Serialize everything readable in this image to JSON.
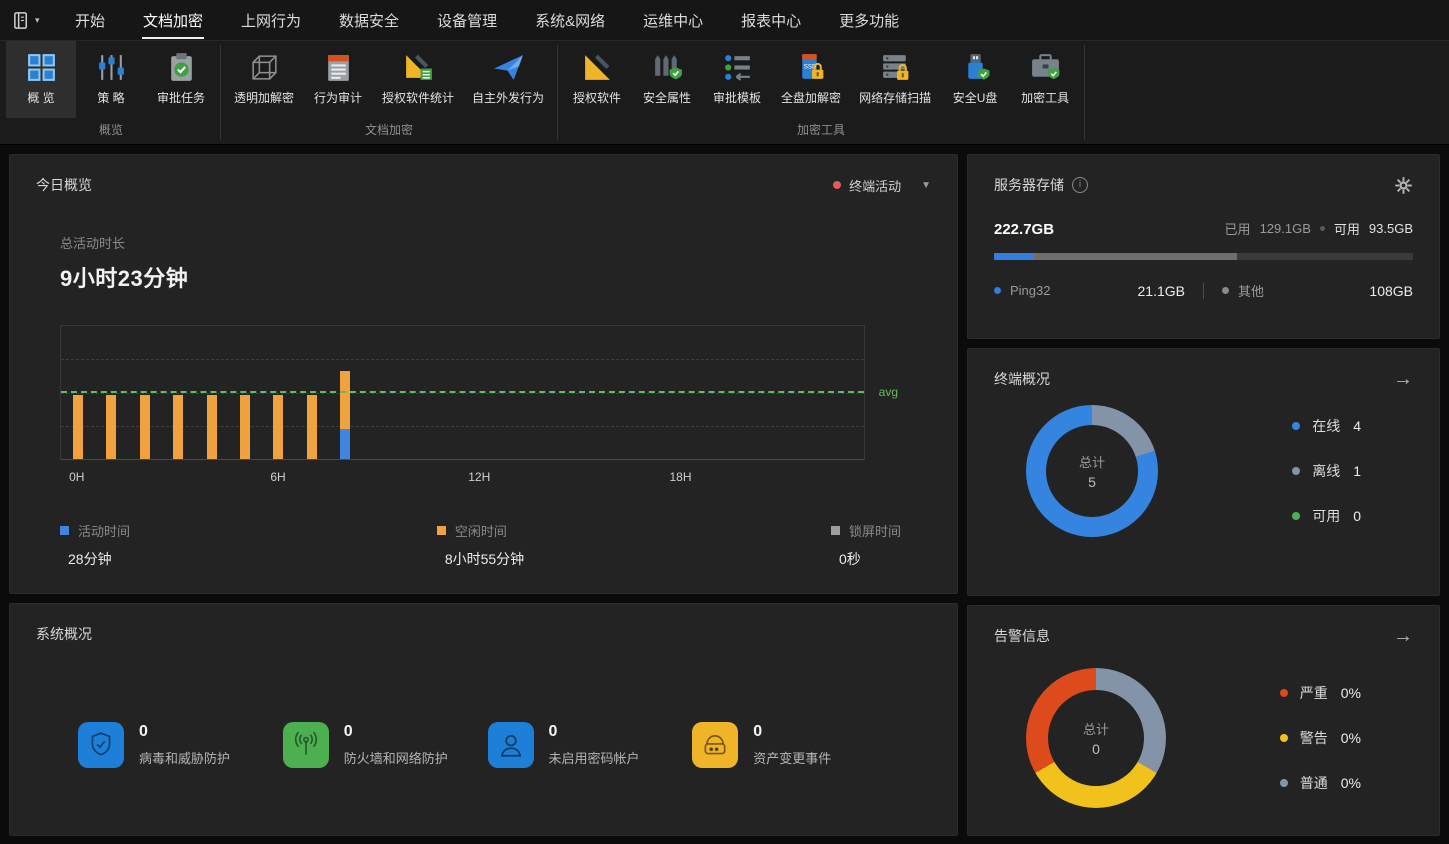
{
  "colors": {
    "red_dot": "#e05b5b",
    "avg_green": "#5fbf60",
    "chart_blue": "#4285e0",
    "chart_orange": "#efa23d",
    "chart_gray": "#9e9e9e"
  },
  "menubar": {
    "items": [
      {
        "label": "开始"
      },
      {
        "label": "文档加密",
        "active": true
      },
      {
        "label": "上网行为"
      },
      {
        "label": "数据安全"
      },
      {
        "label": "设备管理"
      },
      {
        "label": "系统&网络"
      },
      {
        "label": "运维中心"
      },
      {
        "label": "报表中心"
      },
      {
        "label": "更多功能"
      }
    ]
  },
  "ribbon": {
    "groups": [
      {
        "label": "概览",
        "buttons": [
          {
            "label": "概 览",
            "icon": "overview-grid-icon",
            "active": true
          },
          {
            "label": "策 略",
            "icon": "policy-sliders-icon"
          },
          {
            "label": "审批任务",
            "icon": "approval-tasks-icon"
          }
        ]
      },
      {
        "label": "文档加密",
        "buttons": [
          {
            "label": "透明加解密",
            "icon": "transparent-encrypt-icon"
          },
          {
            "label": "行为审计",
            "icon": "behavior-audit-icon"
          },
          {
            "label": "授权软件统计",
            "icon": "authorized-software-stats-icon"
          },
          {
            "label": "自主外发行为",
            "icon": "outgoing-behavior-icon"
          }
        ]
      },
      {
        "label": "加密工具",
        "buttons": [
          {
            "label": "授权软件",
            "icon": "authorized-software-icon"
          },
          {
            "label": "安全属性",
            "icon": "security-attribute-icon"
          },
          {
            "label": "审批模板",
            "icon": "approval-template-icon"
          },
          {
            "label": "全盘加解密",
            "icon": "fulldisk-encrypt-icon"
          },
          {
            "label": "网络存储扫描",
            "icon": "network-storage-scan-icon"
          },
          {
            "label": "安全U盘",
            "icon": "secure-usb-icon"
          },
          {
            "label": "加密工具",
            "icon": "encrypt-tools-icon"
          }
        ]
      }
    ]
  },
  "today": {
    "title": "今日概览",
    "filter_label": "终端活动",
    "metric_label": "总活动时长",
    "metric_value": "9小时23分钟"
  },
  "chart_data": [
    {
      "id": "terminal-activity-by-hour",
      "type": "bar",
      "stacked": true,
      "x_unit": "hour",
      "x_count": 24,
      "x_tick_labels": [
        {
          "slot": 0,
          "label": "0H"
        },
        {
          "slot": 6,
          "label": "6H"
        },
        {
          "slot": 12,
          "label": "12H"
        },
        {
          "slot": 18,
          "label": "18H"
        }
      ],
      "ylabel": "minutes",
      "ylim": [
        0,
        125
      ],
      "grid": "dashed-horizontal",
      "avg_line": {
        "value": 62.5,
        "label": "avg",
        "color": "#5fbf60"
      },
      "series": [
        {
          "name": "活动时间",
          "color": "#4285e0",
          "values": [
            0,
            0,
            0,
            0,
            0,
            0,
            0,
            0,
            28,
            0,
            0,
            0,
            0,
            0,
            0,
            0,
            0,
            0,
            0,
            0,
            0,
            0,
            0,
            0
          ]
        },
        {
          "name": "空闲时间",
          "color": "#efa23d",
          "values": [
            60,
            60,
            60,
            60,
            60,
            60,
            60,
            60,
            55,
            0,
            0,
            0,
            0,
            0,
            0,
            0,
            0,
            0,
            0,
            0,
            0,
            0,
            0,
            0
          ]
        },
        {
          "name": "锁屏时间",
          "color": "#9e9e9e",
          "values": [
            0,
            0,
            0,
            0,
            0,
            0,
            0,
            0,
            0,
            0,
            0,
            0,
            0,
            0,
            0,
            0,
            0,
            0,
            0,
            0,
            0,
            0,
            0,
            0
          ]
        }
      ],
      "legend": [
        {
          "label": "活动时间",
          "value": "28分钟",
          "color": "#4285e0"
        },
        {
          "label": "空闲时间",
          "value": "8小时55分钟",
          "color": "#efa23d"
        },
        {
          "label": "锁屏时间",
          "value": "0秒",
          "color": "#9e9e9e"
        }
      ]
    },
    {
      "id": "terminal-overview",
      "type": "donut",
      "center_label": "总计",
      "center_value": "5",
      "slices": [
        {
          "label": "在线",
          "value": 4,
          "color": "#3585e0"
        },
        {
          "label": "离线",
          "value": 1,
          "color": "#8494a8"
        },
        {
          "label": "可用",
          "value": 0,
          "color": "#4caf50"
        }
      ]
    },
    {
      "id": "alert-info",
      "type": "donut",
      "center_label": "总计",
      "center_value": "0",
      "slices": [
        {
          "label": "严重",
          "value": "0%",
          "color": "#dd4a1c"
        },
        {
          "label": "警告",
          "value": "0%",
          "color": "#f2c21c"
        },
        {
          "label": "普通",
          "value": "0%",
          "color": "#8494a8"
        }
      ]
    }
  ],
  "storage": {
    "title": "服务器存储",
    "total": "222.7GB",
    "used_label": "已用",
    "used_value": "129.1GB",
    "free_label": "可用",
    "free_value": "93.5GB",
    "bar_segments": [
      {
        "name": "Ping32",
        "color": "#2f7ee0",
        "width_pct": "9.5%"
      },
      {
        "name": "其他",
        "color": "#6e6e6e",
        "width_pct": "48.5%"
      }
    ],
    "items": [
      {
        "label": "Ping32",
        "value": "21.1GB",
        "color": "#2f7ee0"
      },
      {
        "label": "其他",
        "value": "108GB",
        "color": "#8a8a8a"
      }
    ]
  },
  "terminal": {
    "title": "终端概况"
  },
  "alerts": {
    "title": "告警信息"
  },
  "system": {
    "title": "系统概况",
    "stats": [
      {
        "value": "0",
        "label": "病毒和威胁防护",
        "icon": "shield-check-icon",
        "bg": "#1e7fd8"
      },
      {
        "value": "0",
        "label": "防火墙和网络防护",
        "icon": "antenna-icon",
        "bg": "#4caf50"
      },
      {
        "value": "0",
        "label": "未启用密码帐户",
        "icon": "user-icon",
        "bg": "#1e7fd8"
      },
      {
        "value": "0",
        "label": "资产变更事件",
        "icon": "asset-device-icon",
        "bg": "#f0b429"
      }
    ]
  }
}
